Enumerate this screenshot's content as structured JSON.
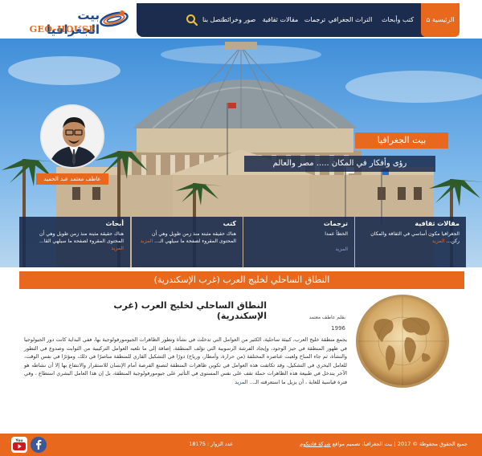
{
  "header": {
    "logo_ar": "بيت الجغرافيا",
    "logo_en": "GEO-HOUSE"
  },
  "nav": {
    "items": [
      {
        "label": "الرئيسية",
        "icon": "home-icon"
      },
      {
        "label": "كتب وأبحاث"
      },
      {
        "label": "التراث الجغرافي"
      },
      {
        "label": "ترجمات"
      },
      {
        "label": "مقالات ثقافية"
      },
      {
        "label": "صور وخرائط"
      },
      {
        "label": "اتصل بنا"
      }
    ],
    "search_icon": "search-icon"
  },
  "hero": {
    "site_title": "بيت الجغرافيا",
    "slogan": "رؤى وأفكار في المكان ..... مصر والعالم",
    "author_label": "عاطف معتمد عبد الحميد"
  },
  "cards": [
    {
      "title": "مقالات ثقافية",
      "body": "الجغرافيا مكون أساسي في الثقافة والمكان ركن...",
      "more": "المزيد"
    },
    {
      "title": "ترجمات",
      "body": "الخطأ عمدا",
      "more": "المزيد"
    },
    {
      "title": "كتب",
      "body": "هناك حقيقة مثبتة منذ زمن طويل وهي أن المحتوى المقروء لصفحة ما سيلهي الـ...",
      "more": "المزيد"
    },
    {
      "title": "أبحاث",
      "body": "هناك حقيقة مثبتة منذ زمن طويل وهي أن المحتوى المقروء لصفحة ما سيلهي القا...",
      "more": "المزيد"
    }
  ],
  "article": {
    "section_title": "النطاق الساحلي لخليج العرب (غرب الإسكندرية)",
    "title": "النطاق الساحلي لخليج العرب (غرب الإسكندرية)",
    "author": "بقلم عاطف معتمد",
    "year": "1996",
    "body": "يجمع منطقة خليج العرب، كبيئة ساحلية، الكثير من العوامل التي تدخلت في نشأة وتطور الظاهرات الجيومورفولوجية بها، ففي البداية كانت دور الجيولوجيا في ظهور المنطقة في حيز الوجود، وإيجاد الفرشة الرسوبية التي تؤلف المنطقة، إضافة إلى ما تلعبه العوامل التركيبية من الثوابت وصدوع في التطور والنشأة، ثم جاء المناخ ولعبت عناصره المختلفة (من حرارة، وأمطار، ورياح) دورًا في التشكيل القاري للمنطقة مناصرًا في ذلك، ومؤثرًا في نفس الوقت، للعامل البحري في التشكيل، وقد تكاتفت هذه العوامل في تكوين ظاهرات المنطقة لتصنع الفرصة أمام الإنسان للاستقرار والانتفاع بها إلا أن نشاطه هو الآخر يتدخل في طبيعة هذه الظاهرات حملة تقف على نفس المستوى في التأثير على جيومورفولوجية المنطقة، بل إن هذا العامل البشري استطاع ، وفي فترة قياسية للغاية ، أن يزيل ما استعرقته الـ...",
    "more": "المزيد"
  },
  "footer": {
    "copyright": "جميع الحقوق محفوظة © 2017 | بيت الجغرافيا، تصميم مواقع",
    "designer_link": "شركة فاديكوم",
    "visits_label": "عدد الزوار : 18175"
  },
  "colors": {
    "accent": "#e8691e",
    "navy": "#1b2c4e"
  }
}
